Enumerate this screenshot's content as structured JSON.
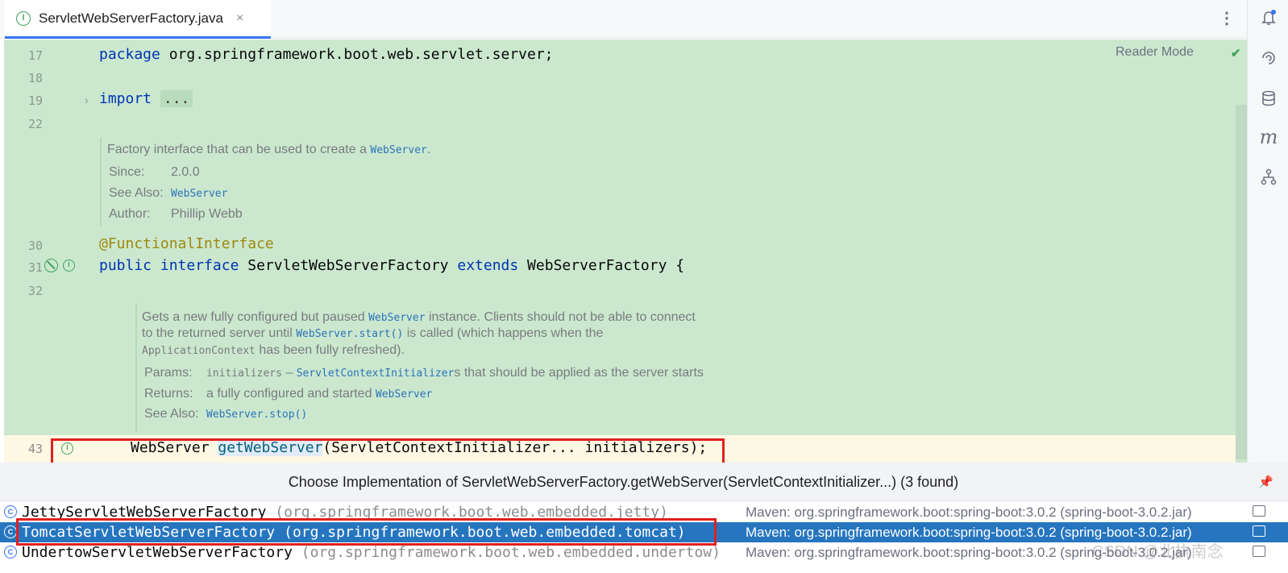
{
  "tab": {
    "icon": "interface-icon",
    "filename": "ServletWebServerFactory.java",
    "close": "×"
  },
  "editor": {
    "reader_mode": "Reader Mode",
    "lines": {
      "l17": "17",
      "l18": "18",
      "l19": "19",
      "l22": "22",
      "l30": "30",
      "l31": "31",
      "l32": "32",
      "l43": "43"
    },
    "code": {
      "pkg_kw": "package",
      "pkg_name": " org.springframework.boot.web.servlet.server;",
      "import_kw": "import",
      "import_dots": "...",
      "annotation": "@FunctionalInterface",
      "decl_public": "public",
      "decl_interface": "interface",
      "decl_name": " ServletWebServerFactory ",
      "decl_extends": "extends",
      "decl_rest": " WebServerFactory {",
      "m_type": "WebServer ",
      "m_name": "getWebServer",
      "m_params": "(ServletContextInitializer... initializers);"
    },
    "doc1": {
      "text": "Factory interface that can be used to create a ",
      "ref": "WebServer",
      "end": ".",
      "since_label": "Since:",
      "since_value": "2.0.0",
      "see_label": "See Also:",
      "see_value": "WebServer",
      "author_label": "Author:",
      "author_value": "Phillip Webb"
    },
    "doc2": {
      "line1a": "Gets a new fully configured but paused ",
      "line1ref": "WebServer",
      "line1b": " instance. Clients should not be able to connect",
      "line2a": "to the returned server until ",
      "line2ref": "WebServer.start()",
      "line2b": " is called (which happens when the",
      "line3ref": "ApplicationContext",
      "line3b": " has been fully refreshed).",
      "params_label": "Params:",
      "params_code": "initializers",
      "params_dash": " – ",
      "params_ref": "ServletContextInitializer",
      "params_rest": "s that should be applied as the server starts",
      "returns_label": "Returns:",
      "returns_text": "a fully configured and started ",
      "returns_ref": "WebServer",
      "see_label": "See Also:",
      "see_ref": "WebServer.stop()"
    }
  },
  "popup": {
    "title": "Choose Implementation of ServletWebServerFactory.getWebServer(ServletContextInitializer...) (3 found)",
    "rows": [
      {
        "name": "JettyServletWebServerFactory",
        "pkg": " (org.springframework.boot.web.embedded.jetty)",
        "maven": "Maven: org.springframework.boot:spring-boot:3.0.2 (spring-boot-3.0.2.jar)",
        "selected": false
      },
      {
        "name": "TomcatServletWebServerFactory",
        "pkg": " (org.springframework.boot.web.embedded.tomcat)",
        "maven": "Maven: org.springframework.boot:spring-boot:3.0.2 (spring-boot-3.0.2.jar)",
        "selected": true
      },
      {
        "name": "UndertowServletWebServerFactory",
        "pkg": " (org.springframework.boot.web.embedded.undertow)",
        "maven": "Maven: org.springframework.boot:spring-boot:3.0.2 (spring-boot-3.0.2.jar)",
        "selected": false
      }
    ]
  },
  "watermark": "CSDN @北执南念",
  "colors": {
    "editor_bg": "#cbe8cf",
    "selection": "#2675bf",
    "highlight_box": "#e0201f",
    "keyword": "#0033b3",
    "annotation": "#9e880d"
  }
}
